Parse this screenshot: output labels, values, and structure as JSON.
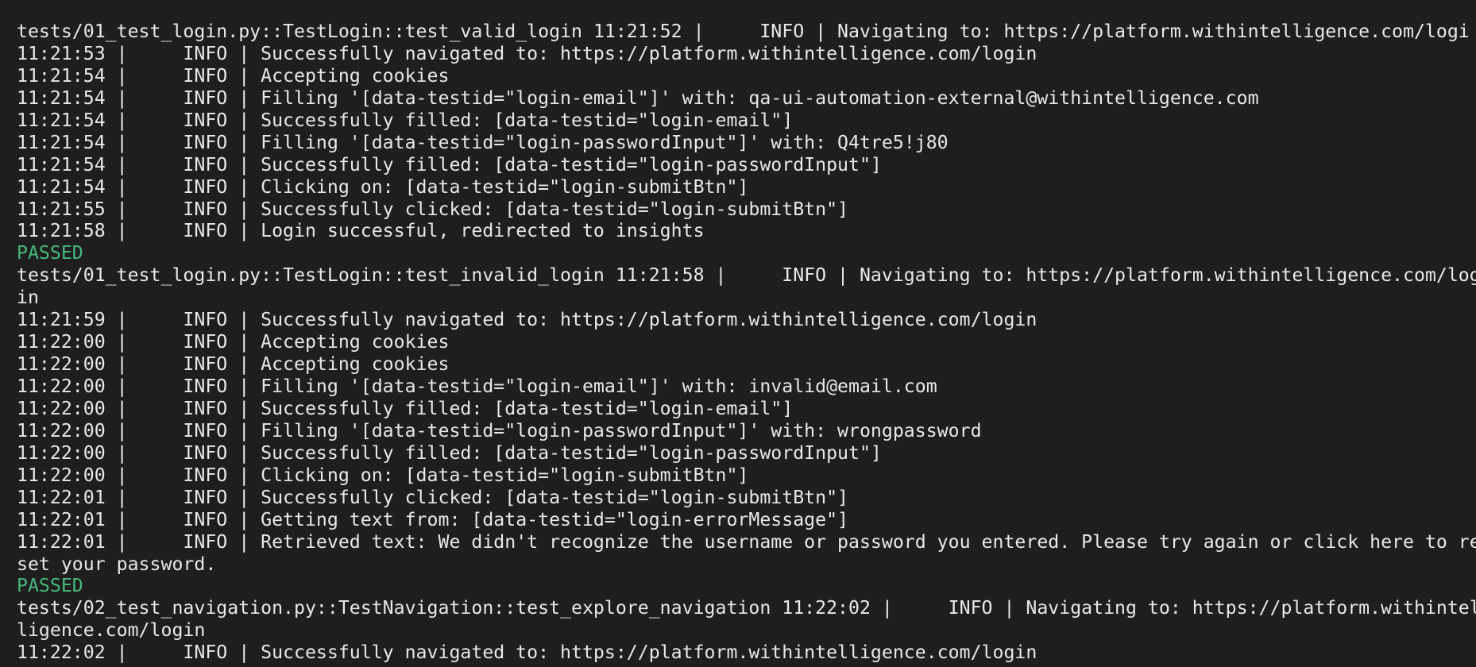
{
  "terminal": {
    "lines": [
      {
        "text": "tests/01_test_login.py::TestLogin::test_valid_login 11:21:52 |     INFO | Navigating to: https://platform.withintelligence.com/logi",
        "status": false
      },
      {
        "text": "11:21:53 |     INFO | Successfully navigated to: https://platform.withintelligence.com/login",
        "status": false
      },
      {
        "text": "11:21:54 |     INFO | Accepting cookies",
        "status": false
      },
      {
        "text": "11:21:54 |     INFO | Filling '[data-testid=\"login-email\"]' with: qa-ui-automation-external@withintelligence.com",
        "status": false
      },
      {
        "text": "11:21:54 |     INFO | Successfully filled: [data-testid=\"login-email\"]",
        "status": false
      },
      {
        "text": "11:21:54 |     INFO | Filling '[data-testid=\"login-passwordInput\"]' with: Q4tre5!j80",
        "status": false
      },
      {
        "text": "11:21:54 |     INFO | Successfully filled: [data-testid=\"login-passwordInput\"]",
        "status": false
      },
      {
        "text": "11:21:54 |     INFO | Clicking on: [data-testid=\"login-submitBtn\"]",
        "status": false
      },
      {
        "text": "11:21:55 |     INFO | Successfully clicked: [data-testid=\"login-submitBtn\"]",
        "status": false
      },
      {
        "text": "11:21:58 |     INFO | Login successful, redirected to insights",
        "status": false
      },
      {
        "text": "PASSED",
        "status": true
      },
      {
        "text": "tests/01_test_login.py::TestLogin::test_invalid_login 11:21:58 |     INFO | Navigating to: https://platform.withintelligence.com/log",
        "status": false
      },
      {
        "text": "in",
        "status": false
      },
      {
        "text": "11:21:59 |     INFO | Successfully navigated to: https://platform.withintelligence.com/login",
        "status": false
      },
      {
        "text": "11:22:00 |     INFO | Accepting cookies",
        "status": false
      },
      {
        "text": "11:22:00 |     INFO | Accepting cookies",
        "status": false
      },
      {
        "text": "11:22:00 |     INFO | Filling '[data-testid=\"login-email\"]' with: invalid@email.com",
        "status": false
      },
      {
        "text": "11:22:00 |     INFO | Successfully filled: [data-testid=\"login-email\"]",
        "status": false
      },
      {
        "text": "11:22:00 |     INFO | Filling '[data-testid=\"login-passwordInput\"]' with: wrongpassword",
        "status": false
      },
      {
        "text": "11:22:00 |     INFO | Successfully filled: [data-testid=\"login-passwordInput\"]",
        "status": false
      },
      {
        "text": "11:22:00 |     INFO | Clicking on: [data-testid=\"login-submitBtn\"]",
        "status": false
      },
      {
        "text": "11:22:01 |     INFO | Successfully clicked: [data-testid=\"login-submitBtn\"]",
        "status": false
      },
      {
        "text": "11:22:01 |     INFO | Getting text from: [data-testid=\"login-errorMessage\"]",
        "status": false
      },
      {
        "text": "11:22:01 |     INFO | Retrieved text: We didn't recognize the username or password you entered. Please try again or click here to re",
        "status": false
      },
      {
        "text": "set your password.",
        "status": false
      },
      {
        "text": "PASSED",
        "status": true
      },
      {
        "text": "tests/02_test_navigation.py::TestNavigation::test_explore_navigation 11:22:02 |     INFO | Navigating to: https://platform.withintel",
        "status": false
      },
      {
        "text": "ligence.com/login",
        "status": false
      },
      {
        "text": "11:22:02 |     INFO | Successfully navigated to: https://platform.withintelligence.com/login",
        "status": false
      }
    ]
  },
  "colors": {
    "background": "#1e1e1e",
    "foreground": "#e8e8e8",
    "passed": "#47b97a"
  }
}
